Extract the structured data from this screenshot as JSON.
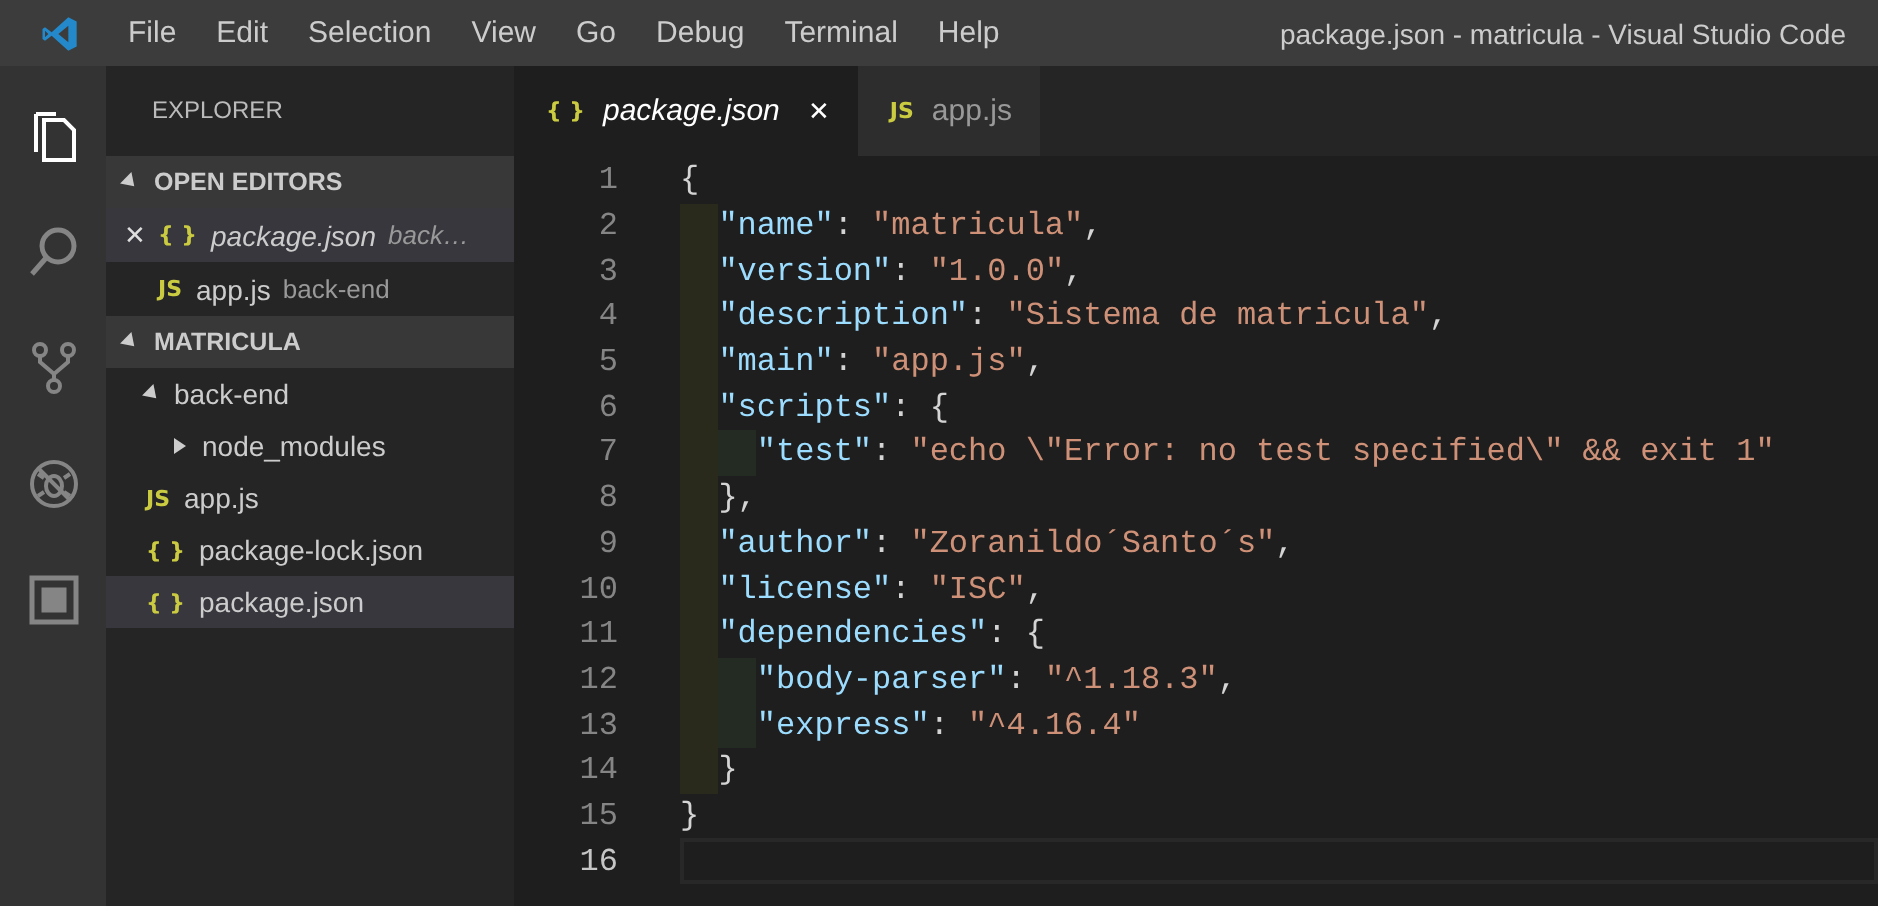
{
  "window": {
    "title": "package.json - matricula - Visual Studio Code"
  },
  "menu": [
    "File",
    "Edit",
    "Selection",
    "View",
    "Go",
    "Debug",
    "Terminal",
    "Help"
  ],
  "activity_bar": [
    {
      "kind": "files",
      "selected": true
    },
    {
      "kind": "search",
      "selected": false
    },
    {
      "kind": "git",
      "selected": false
    },
    {
      "kind": "debug",
      "selected": false
    },
    {
      "kind": "extensions",
      "selected": false
    }
  ],
  "sidebar": {
    "title": "EXPLORER",
    "open_editors": {
      "title": "OPEN EDITORS",
      "expanded": true,
      "items": [
        {
          "close": "✕",
          "icon": "{ }",
          "name": "package.json",
          "path": "back…",
          "preview": true,
          "selected": true
        },
        {
          "icon": "JS",
          "name": "app.js",
          "path": "back-end",
          "preview": false,
          "selected": false
        }
      ]
    },
    "folder": {
      "title": "MATRICULA",
      "expanded": true,
      "children": [
        {
          "name": "back-end",
          "kind": "folder",
          "expanded": true,
          "selected": false,
          "children": [
            {
              "name": "node_modules",
              "kind": "folder",
              "expanded": false,
              "selected": false
            }
          ]
        },
        {
          "name": "app.js",
          "kind": "file",
          "icon": "JS",
          "selected": false
        },
        {
          "name": "package-lock.json",
          "kind": "file",
          "icon": "{ }",
          "selected": false
        },
        {
          "name": "package.json",
          "kind": "file",
          "icon": "{ }",
          "selected": true
        }
      ]
    }
  },
  "tabs": [
    {
      "icon": "{ }",
      "label": "package.json",
      "close": "✕",
      "preview": true,
      "selected": true
    },
    {
      "icon": "JS",
      "label": "app.js",
      "preview": false,
      "selected": false
    }
  ],
  "editor": {
    "lines": [
      {
        "number": "1",
        "current": false,
        "tokens": [
          {
            "kind": "punct",
            "text": "{"
          }
        ]
      },
      {
        "number": "2",
        "current": false,
        "tokens": [
          {
            "kind": "key",
            "text": "  \"name\""
          },
          {
            "kind": "punct",
            "text": ": "
          },
          {
            "kind": "string",
            "text": "\"matricula\""
          },
          {
            "kind": "punct",
            "text": ","
          }
        ]
      },
      {
        "number": "3",
        "current": false,
        "tokens": [
          {
            "kind": "key",
            "text": "  \"version\""
          },
          {
            "kind": "punct",
            "text": ": "
          },
          {
            "kind": "string",
            "text": "\"1.0.0\""
          },
          {
            "kind": "punct",
            "text": ","
          }
        ]
      },
      {
        "number": "4",
        "current": false,
        "tokens": [
          {
            "kind": "key",
            "text": "  \"description\""
          },
          {
            "kind": "punct",
            "text": ": "
          },
          {
            "kind": "string",
            "text": "\"Sistema de matricula\""
          },
          {
            "kind": "punct",
            "text": ","
          }
        ]
      },
      {
        "number": "5",
        "current": false,
        "tokens": [
          {
            "kind": "key",
            "text": "  \"main\""
          },
          {
            "kind": "punct",
            "text": ": "
          },
          {
            "kind": "string",
            "text": "\"app.js\""
          },
          {
            "kind": "punct",
            "text": ","
          }
        ]
      },
      {
        "number": "6",
        "current": false,
        "tokens": [
          {
            "kind": "key",
            "text": "  \"scripts\""
          },
          {
            "kind": "punct",
            "text": ": {"
          }
        ]
      },
      {
        "number": "7",
        "current": false,
        "tokens": [
          {
            "kind": "key",
            "text": "    \"test\""
          },
          {
            "kind": "punct",
            "text": ": "
          },
          {
            "kind": "string",
            "text": "\"echo \\\"Error: no test specified\\\" && exit 1\""
          }
        ]
      },
      {
        "number": "8",
        "current": false,
        "tokens": [
          {
            "kind": "punct",
            "text": "  },"
          }
        ]
      },
      {
        "number": "9",
        "current": false,
        "tokens": [
          {
            "kind": "key",
            "text": "  \"author\""
          },
          {
            "kind": "punct",
            "text": ": "
          },
          {
            "kind": "string",
            "text": "\"Zoranildo´Santo´s\""
          },
          {
            "kind": "punct",
            "text": ","
          }
        ]
      },
      {
        "number": "10",
        "current": false,
        "tokens": [
          {
            "kind": "key",
            "text": "  \"license\""
          },
          {
            "kind": "punct",
            "text": ": "
          },
          {
            "kind": "string",
            "text": "\"ISC\""
          },
          {
            "kind": "punct",
            "text": ","
          }
        ]
      },
      {
        "number": "11",
        "current": false,
        "tokens": [
          {
            "kind": "key",
            "text": "  \"dependencies\""
          },
          {
            "kind": "punct",
            "text": ": {"
          }
        ]
      },
      {
        "number": "12",
        "current": false,
        "tokens": [
          {
            "kind": "key",
            "text": "    \"body-parser\""
          },
          {
            "kind": "punct",
            "text": ": "
          },
          {
            "kind": "string",
            "text": "\"^1.18.3\""
          },
          {
            "kind": "punct",
            "text": ","
          }
        ]
      },
      {
        "number": "13",
        "current": false,
        "tokens": [
          {
            "kind": "key",
            "text": "    \"express\""
          },
          {
            "kind": "punct",
            "text": ": "
          },
          {
            "kind": "string",
            "text": "\"^4.16.4\""
          }
        ]
      },
      {
        "number": "14",
        "current": false,
        "tokens": [
          {
            "kind": "punct",
            "text": "  }"
          }
        ]
      },
      {
        "number": "15",
        "current": false,
        "tokens": [
          {
            "kind": "punct",
            "text": "}"
          }
        ]
      },
      {
        "number": "16",
        "current": true
      }
    ]
  }
}
